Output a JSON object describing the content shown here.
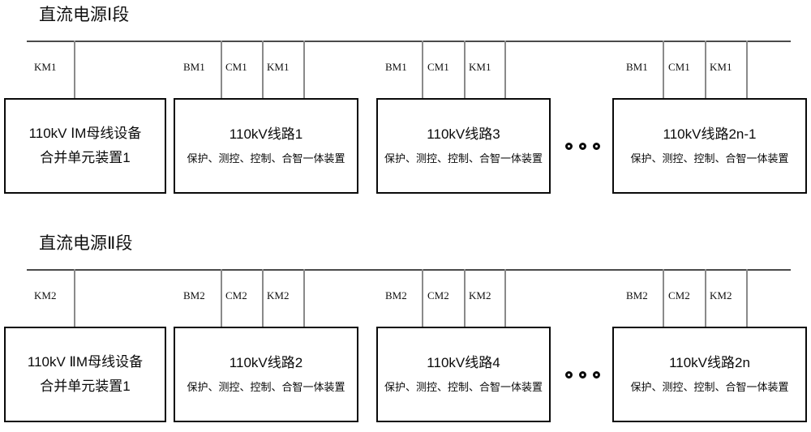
{
  "diagram": {
    "title_top": "直流电源Ⅰ段",
    "title_bottom": "直流电源Ⅱ段",
    "ellipsis_symbol": "●●●"
  },
  "sections": [
    {
      "id": "dc-power-section-1",
      "title": "直流电源Ⅰ段",
      "groups": [
        {
          "id": "merging-unit-1",
          "type": "merging-unit",
          "title_line1": "110kV ⅠM母线设备",
          "title_line2": "合并单元装置1",
          "subtitle": "",
          "branches": [
            {
              "label": "KM1"
            }
          ]
        },
        {
          "id": "line-1",
          "type": "line-device",
          "title_line1": "110kV线路1",
          "title_line2": "",
          "subtitle": "保护、测控、控制、合智一体装置",
          "branches": [
            {
              "label": "BM1"
            },
            {
              "label": "CM1"
            },
            {
              "label": "KM1"
            }
          ]
        },
        {
          "id": "line-3",
          "type": "line-device",
          "title_line1": "110kV线路3",
          "title_line2": "",
          "subtitle": "保护、测控、控制、合智一体装置",
          "branches": [
            {
              "label": "BM1"
            },
            {
              "label": "CM1"
            },
            {
              "label": "KM1"
            }
          ]
        },
        {
          "id": "line-2n-minus-1",
          "type": "line-device",
          "title_line1": "110kV线路2n-1",
          "title_line2": "",
          "subtitle": "保护、测控、控制、合智一体装置",
          "branches": [
            {
              "label": "BM1"
            },
            {
              "label": "CM1"
            },
            {
              "label": "KM1"
            }
          ]
        }
      ]
    },
    {
      "id": "dc-power-section-2",
      "title": "直流电源Ⅱ段",
      "groups": [
        {
          "id": "merging-unit-2",
          "type": "merging-unit",
          "title_line1": "110kV ⅡM母线设备",
          "title_line2": "合并单元装置1",
          "subtitle": "",
          "branches": [
            {
              "label": "KM2"
            }
          ]
        },
        {
          "id": "line-2",
          "type": "line-device",
          "title_line1": "110kV线路2",
          "title_line2": "",
          "subtitle": "保护、测控、控制、合智一体装置",
          "branches": [
            {
              "label": "BM2"
            },
            {
              "label": "CM2"
            },
            {
              "label": "KM2"
            }
          ]
        },
        {
          "id": "line-4",
          "type": "line-device",
          "title_line1": "110kV线路4",
          "title_line2": "",
          "subtitle": "保护、测控、控制、合智一体装置",
          "branches": [
            {
              "label": "BM2"
            },
            {
              "label": "CM2"
            },
            {
              "label": "KM2"
            }
          ]
        },
        {
          "id": "line-2n",
          "type": "line-device",
          "title_line1": "110kV线路2n",
          "title_line2": "",
          "subtitle": "保护、测控、控制、合智一体装置",
          "branches": [
            {
              "label": "BM2"
            },
            {
              "label": "CM2"
            },
            {
              "label": "KM2"
            }
          ]
        }
      ]
    }
  ],
  "colors": {
    "bus_line": "#4a4a4a",
    "drop_line": "#8a8a8a",
    "box_border": "#0a0a0a",
    "text": "#111111",
    "background": "#ffffff"
  }
}
